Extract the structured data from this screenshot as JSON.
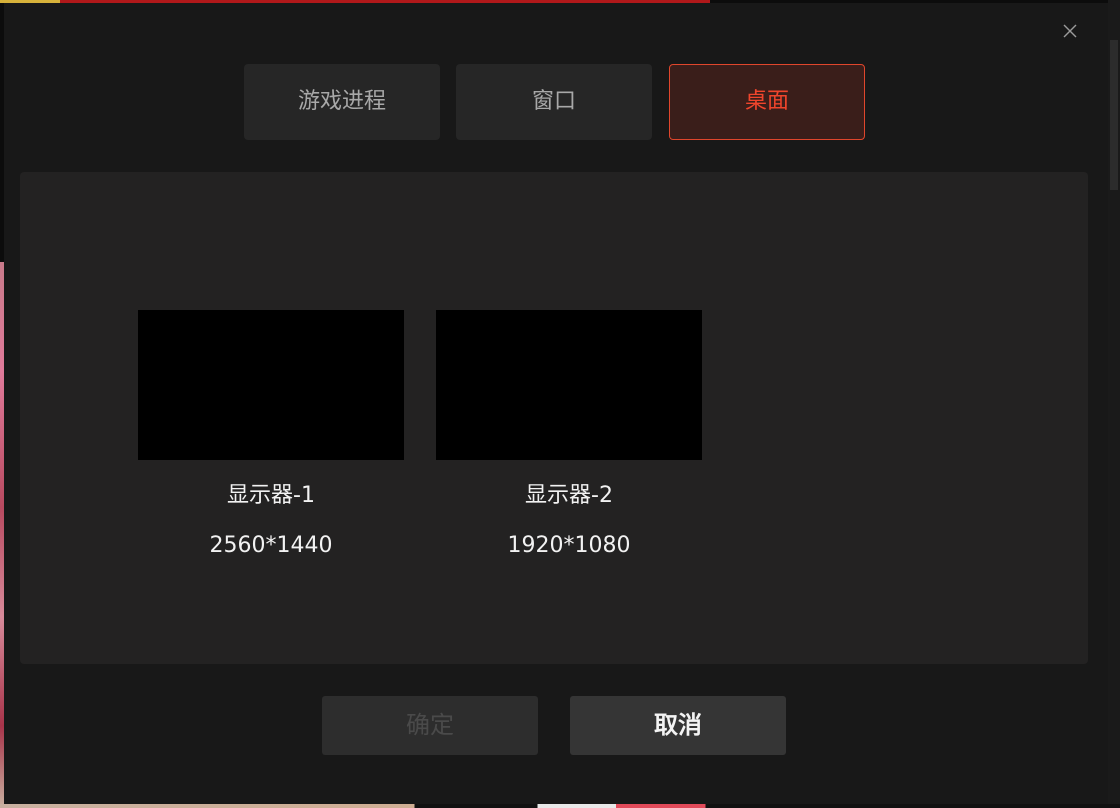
{
  "dialog": {
    "tabs": [
      {
        "label": "游戏进程",
        "active": false
      },
      {
        "label": "窗口",
        "active": false
      },
      {
        "label": "桌面",
        "active": true
      }
    ],
    "monitors": [
      {
        "name": "显示器-1",
        "resolution": "2560*1440"
      },
      {
        "name": "显示器-2",
        "resolution": "1920*1080"
      }
    ],
    "buttons": {
      "confirm_label": "确定",
      "confirm_disabled": true,
      "cancel_label": "取消"
    },
    "close_icon": "close-icon"
  },
  "colors": {
    "accent": "#f0452c",
    "active_tab_bg": "#3a1e1a",
    "dialog_bg": "#181818",
    "panel_bg": "#232222",
    "tab_bg": "#262626"
  }
}
